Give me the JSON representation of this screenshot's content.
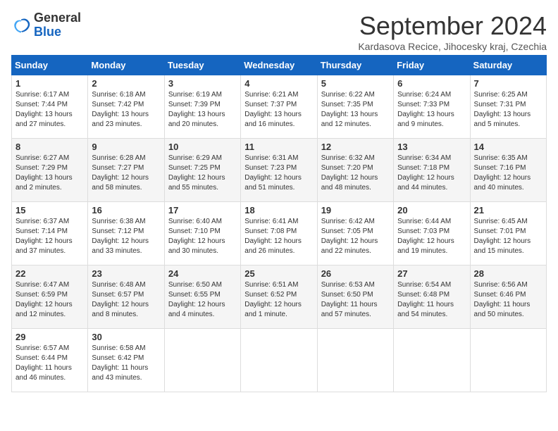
{
  "logo": {
    "line1": "General",
    "line2": "Blue"
  },
  "title": "September 2024",
  "subtitle": "Kardasova Recice, Jihocesky kraj, Czechia",
  "days_header": [
    "Sunday",
    "Monday",
    "Tuesday",
    "Wednesday",
    "Thursday",
    "Friday",
    "Saturday"
  ],
  "weeks": [
    [
      {
        "num": "1",
        "lines": [
          "Sunrise: 6:17 AM",
          "Sunset: 7:44 PM",
          "Daylight: 13 hours",
          "and 27 minutes."
        ]
      },
      {
        "num": "2",
        "lines": [
          "Sunrise: 6:18 AM",
          "Sunset: 7:42 PM",
          "Daylight: 13 hours",
          "and 23 minutes."
        ]
      },
      {
        "num": "3",
        "lines": [
          "Sunrise: 6:19 AM",
          "Sunset: 7:39 PM",
          "Daylight: 13 hours",
          "and 20 minutes."
        ]
      },
      {
        "num": "4",
        "lines": [
          "Sunrise: 6:21 AM",
          "Sunset: 7:37 PM",
          "Daylight: 13 hours",
          "and 16 minutes."
        ]
      },
      {
        "num": "5",
        "lines": [
          "Sunrise: 6:22 AM",
          "Sunset: 7:35 PM",
          "Daylight: 13 hours",
          "and 12 minutes."
        ]
      },
      {
        "num": "6",
        "lines": [
          "Sunrise: 6:24 AM",
          "Sunset: 7:33 PM",
          "Daylight: 13 hours",
          "and 9 minutes."
        ]
      },
      {
        "num": "7",
        "lines": [
          "Sunrise: 6:25 AM",
          "Sunset: 7:31 PM",
          "Daylight: 13 hours",
          "and 5 minutes."
        ]
      }
    ],
    [
      {
        "num": "8",
        "lines": [
          "Sunrise: 6:27 AM",
          "Sunset: 7:29 PM",
          "Daylight: 13 hours",
          "and 2 minutes."
        ]
      },
      {
        "num": "9",
        "lines": [
          "Sunrise: 6:28 AM",
          "Sunset: 7:27 PM",
          "Daylight: 12 hours",
          "and 58 minutes."
        ]
      },
      {
        "num": "10",
        "lines": [
          "Sunrise: 6:29 AM",
          "Sunset: 7:25 PM",
          "Daylight: 12 hours",
          "and 55 minutes."
        ]
      },
      {
        "num": "11",
        "lines": [
          "Sunrise: 6:31 AM",
          "Sunset: 7:23 PM",
          "Daylight: 12 hours",
          "and 51 minutes."
        ]
      },
      {
        "num": "12",
        "lines": [
          "Sunrise: 6:32 AM",
          "Sunset: 7:20 PM",
          "Daylight: 12 hours",
          "and 48 minutes."
        ]
      },
      {
        "num": "13",
        "lines": [
          "Sunrise: 6:34 AM",
          "Sunset: 7:18 PM",
          "Daylight: 12 hours",
          "and 44 minutes."
        ]
      },
      {
        "num": "14",
        "lines": [
          "Sunrise: 6:35 AM",
          "Sunset: 7:16 PM",
          "Daylight: 12 hours",
          "and 40 minutes."
        ]
      }
    ],
    [
      {
        "num": "15",
        "lines": [
          "Sunrise: 6:37 AM",
          "Sunset: 7:14 PM",
          "Daylight: 12 hours",
          "and 37 minutes."
        ]
      },
      {
        "num": "16",
        "lines": [
          "Sunrise: 6:38 AM",
          "Sunset: 7:12 PM",
          "Daylight: 12 hours",
          "and 33 minutes."
        ]
      },
      {
        "num": "17",
        "lines": [
          "Sunrise: 6:40 AM",
          "Sunset: 7:10 PM",
          "Daylight: 12 hours",
          "and 30 minutes."
        ]
      },
      {
        "num": "18",
        "lines": [
          "Sunrise: 6:41 AM",
          "Sunset: 7:08 PM",
          "Daylight: 12 hours",
          "and 26 minutes."
        ]
      },
      {
        "num": "19",
        "lines": [
          "Sunrise: 6:42 AM",
          "Sunset: 7:05 PM",
          "Daylight: 12 hours",
          "and 22 minutes."
        ]
      },
      {
        "num": "20",
        "lines": [
          "Sunrise: 6:44 AM",
          "Sunset: 7:03 PM",
          "Daylight: 12 hours",
          "and 19 minutes."
        ]
      },
      {
        "num": "21",
        "lines": [
          "Sunrise: 6:45 AM",
          "Sunset: 7:01 PM",
          "Daylight: 12 hours",
          "and 15 minutes."
        ]
      }
    ],
    [
      {
        "num": "22",
        "lines": [
          "Sunrise: 6:47 AM",
          "Sunset: 6:59 PM",
          "Daylight: 12 hours",
          "and 12 minutes."
        ]
      },
      {
        "num": "23",
        "lines": [
          "Sunrise: 6:48 AM",
          "Sunset: 6:57 PM",
          "Daylight: 12 hours",
          "and 8 minutes."
        ]
      },
      {
        "num": "24",
        "lines": [
          "Sunrise: 6:50 AM",
          "Sunset: 6:55 PM",
          "Daylight: 12 hours",
          "and 4 minutes."
        ]
      },
      {
        "num": "25",
        "lines": [
          "Sunrise: 6:51 AM",
          "Sunset: 6:52 PM",
          "Daylight: 12 hours",
          "and 1 minute."
        ]
      },
      {
        "num": "26",
        "lines": [
          "Sunrise: 6:53 AM",
          "Sunset: 6:50 PM",
          "Daylight: 11 hours",
          "and 57 minutes."
        ]
      },
      {
        "num": "27",
        "lines": [
          "Sunrise: 6:54 AM",
          "Sunset: 6:48 PM",
          "Daylight: 11 hours",
          "and 54 minutes."
        ]
      },
      {
        "num": "28",
        "lines": [
          "Sunrise: 6:56 AM",
          "Sunset: 6:46 PM",
          "Daylight: 11 hours",
          "and 50 minutes."
        ]
      }
    ],
    [
      {
        "num": "29",
        "lines": [
          "Sunrise: 6:57 AM",
          "Sunset: 6:44 PM",
          "Daylight: 11 hours",
          "and 46 minutes."
        ]
      },
      {
        "num": "30",
        "lines": [
          "Sunrise: 6:58 AM",
          "Sunset: 6:42 PM",
          "Daylight: 11 hours",
          "and 43 minutes."
        ]
      },
      null,
      null,
      null,
      null,
      null
    ]
  ]
}
